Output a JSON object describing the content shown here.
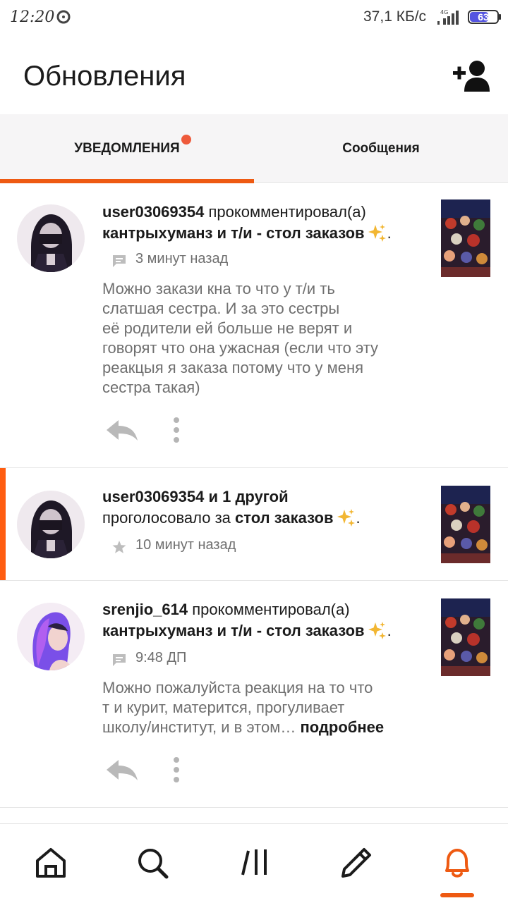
{
  "status_bar": {
    "time": "12:20",
    "net_speed": "37,1 КБ/с",
    "network_type": "4G",
    "battery": "63"
  },
  "header": {
    "title": "Обновления",
    "add_friend_icon": "add-person-icon"
  },
  "tabs": [
    {
      "label": "УВЕДОМЛЕНИЯ",
      "active": true,
      "has_badge": true
    },
    {
      "label": "Сообщения",
      "active": false,
      "has_badge": false
    }
  ],
  "feed": [
    {
      "user": "user03069354",
      "action": "прокомментировал(а)",
      "target": "кантрыхуманз и т/и - стол заказов",
      "time": "3 минут назад",
      "meta_icon": "comment-icon",
      "comment_lines": [
        "Можно закази кна то что у т/и ть",
        "слатшая сестра. И за это сестры",
        "её родители ей больше не верят и",
        "говорят что она ужасная (если что эту",
        "реакцыя я заказа потому что у меня",
        "сестра такая)"
      ]
    },
    {
      "user": "user03069354 и 1 другой",
      "action": "проголосовало за",
      "target": "стол заказов",
      "time": "10 минут назад",
      "meta_icon": "star-icon",
      "highlighted": true
    },
    {
      "user": "srenjio_614",
      "action": "прокомментировал(а)",
      "target": "кантрыхуманз и т/и - стол заказов",
      "time": "9:48 ДП",
      "meta_icon": "comment-icon",
      "comment_lines": [
        "Можно пожалуйста реакция на то что",
        "т и курит, матерится, прогуливает",
        "школу/институт, и в этом…"
      ],
      "more_label": "подробнее"
    }
  ],
  "bottom_nav": [
    {
      "icon": "home-icon",
      "active": false
    },
    {
      "icon": "search-icon",
      "active": false
    },
    {
      "icon": "library-icon",
      "active": false
    },
    {
      "icon": "pencil-icon",
      "active": false
    },
    {
      "icon": "bell-icon",
      "active": true
    }
  ],
  "colors": {
    "accent": "#ee5a12",
    "badge": "#ee5a3b",
    "muted_text": "#6f6f6f",
    "tab_bg": "#f6f5f6"
  }
}
